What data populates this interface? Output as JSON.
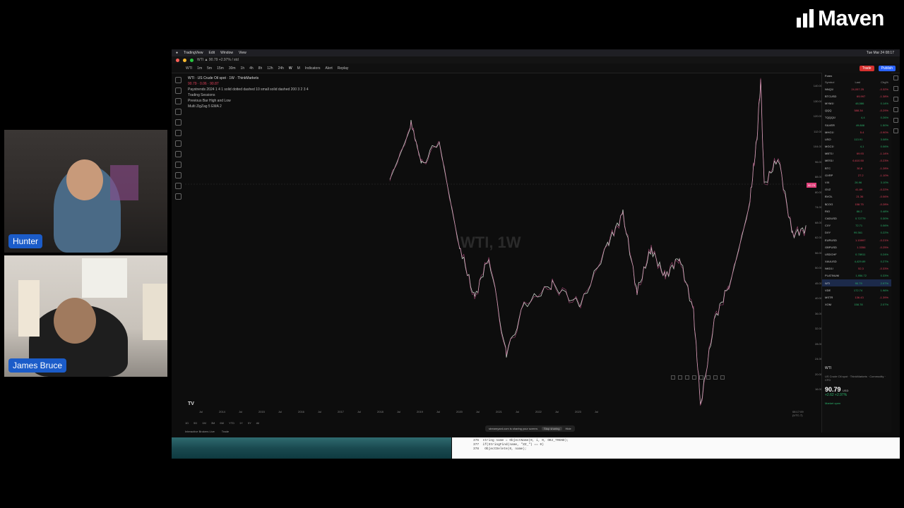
{
  "brand": {
    "name": "Maven"
  },
  "participants": [
    {
      "name": "Hunter"
    },
    {
      "name": "James Bruce"
    }
  ],
  "mac_menu": {
    "app": "TradingView",
    "items": [
      "Edit",
      "Window",
      "View"
    ],
    "datetime": "Tue Mar 24 08:17"
  },
  "browser_tab": {
    "title": "WTI ▲ 90.79 +2.97% / std"
  },
  "toolbar": {
    "symbol": "WTI",
    "intervals": [
      "1m",
      "5m",
      "15m",
      "30m",
      "1h",
      "4h",
      "8h",
      "12h",
      "24h",
      "W",
      "M"
    ],
    "indicators_label": "Indicators",
    "alert_label": "Alert",
    "replay_label": "Replay",
    "trade_label": "Trade",
    "publish_label": "Publish"
  },
  "chart": {
    "title": "WTI · US Crude Oil spot · 1W · ThinkMarkets",
    "ohlc_line": "90.79 · 0.06 · 90.87",
    "indicator_line": "Paystrends 2024 1 4 1 solid dotted dashed 10 small solid dashed 200 3 2 3 4",
    "indicators": [
      "Trading Sessions",
      "Previous Bar High and Low",
      "Multi ZigZag 5 EMA 2"
    ],
    "watermark": "WTI, 1W",
    "price_tag": "90.79",
    "time_labels": [
      "Jul",
      "2014",
      "Jul",
      "2015",
      "Jul",
      "2016",
      "Jul",
      "2017",
      "Jul",
      "2018",
      "Jul",
      "2019",
      "Jul",
      "2020",
      "Jul",
      "2021",
      "Jul",
      "2022",
      "Jul",
      "2023",
      "Jul"
    ],
    "timestamp": "08:17:09 (UTC-7)",
    "price_labels": [
      "140.00",
      "130.00",
      "120.00",
      "112.00",
      "104.00",
      "96.00",
      "88.00",
      "80.00",
      "74.00",
      "68.00",
      "62.00",
      "56.00",
      "50.00",
      "45.00",
      "40.00",
      "36.00",
      "32.00",
      "28.00",
      "24.00",
      "20.00",
      "16.00"
    ],
    "usd_label": "USD"
  },
  "bottom_bar": {
    "ranges": [
      "1D",
      "5D",
      "1M",
      "3M",
      "6M",
      "YTD",
      "1Y",
      "5Y",
      "All"
    ],
    "broker": "Interactive Brokers Live",
    "trade": "Trade"
  },
  "screenshare": {
    "text": "streamyard.com is sharing your screen.",
    "stop": "Stop sharing",
    "hide": "Hide"
  },
  "watchlist": {
    "title": "Forex",
    "headers": {
      "symbol": "Symbol",
      "last": "Last",
      "chg": "Chg%"
    },
    "rows": [
      {
        "symbol": "NNQ1!",
        "last": "24,057.25",
        "chg": "-0.32%",
        "dir": "down"
      },
      {
        "symbol": "BTCUSD",
        "last": "69,997",
        "chg": "-1.38%",
        "dir": "down"
      },
      {
        "symbol": "MYM1!",
        "last": "48,586",
        "chg": "0.14%",
        "dir": "up"
      },
      {
        "symbol": "QQQ",
        "last": "588.34",
        "chg": "-0.29%",
        "dir": "down"
      },
      {
        "symbol": "TQQQ1!",
        "last": "4,4",
        "chg": "0.26%",
        "dir": "up"
      },
      {
        "symbol": "SILVER",
        "last": "49.888",
        "chg": "1.50%",
        "dir": "up"
      },
      {
        "symbol": "MHG1!",
        "last": "5.4",
        "chg": "-0.90%",
        "dir": "down"
      },
      {
        "symbol": "USO",
        "last": "113.91",
        "chg": "3.08%",
        "dir": "up"
      },
      {
        "symbol": "MGC1!",
        "last": "4,1",
        "chg": "0.06%",
        "dir": "up"
      },
      {
        "symbol": "MBT1!",
        "last": "69.93",
        "chg": "-1.14%",
        "dir": "down"
      },
      {
        "symbol": "MES1!",
        "last": "6,610.50",
        "chg": "-0.23%",
        "dir": "down"
      },
      {
        "symbol": "BTC",
        "last": "30.8",
        "chg": "-1.28%",
        "dir": "down"
      },
      {
        "symbol": "GXRP",
        "last": "27.2",
        "chg": "-1.10%",
        "dir": "down"
      },
      {
        "symbol": "VIX",
        "last": "26.96",
        "chg": "3.10%",
        "dir": "up"
      },
      {
        "symbol": "GVZ",
        "last": "41.89",
        "chg": "-0.22%",
        "dir": "down"
      },
      {
        "symbol": "BVOL",
        "last": "21.36",
        "chg": "-0.06%",
        "dir": "down"
      },
      {
        "symbol": "$COG",
        "last": "158.75",
        "chg": "-0.28%",
        "dir": "down"
      },
      {
        "symbol": "RIO",
        "last": "86.2",
        "chg": "0.48%",
        "dir": "up"
      },
      {
        "symbol": "CADUSD",
        "last": "0.72779",
        "chg": "0.30%",
        "dir": "up"
      },
      {
        "symbol": "CXY",
        "last": "72.71",
        "chg": "0.06%",
        "dir": "up"
      },
      {
        "symbol": "DXY",
        "last": "99.361",
        "chg": "0.22%",
        "dir": "up"
      },
      {
        "symbol": "EURUSD",
        "last": "1.15997",
        "chg": "-0.21%",
        "dir": "down"
      },
      {
        "symbol": "GBPUSD",
        "last": "1.3356",
        "chg": "-0.25%",
        "dir": "down"
      },
      {
        "symbol": "USDCHF",
        "last": "0.78911",
        "chg": "0.24%",
        "dir": "up"
      },
      {
        "symbol": "XAUUSD",
        "last": "4,429.89",
        "chg": "0.27%",
        "dir": "up"
      },
      {
        "symbol": "NKD1!",
        "last": "52,3",
        "chg": "-0.33%",
        "dir": "down"
      },
      {
        "symbol": "PLATINUM",
        "last": "1,956.72",
        "chg": "0.33%",
        "dir": "up"
      },
      {
        "symbol": "WTI",
        "last": "90.79",
        "chg": "2.97%",
        "dir": "up",
        "selected": true
      },
      {
        "symbol": "VDE",
        "last": "172.74",
        "chg": "1.96%",
        "dir": "up"
      },
      {
        "symbol": "MSTR",
        "last": "136.43",
        "chg": "-1.39%",
        "dir": "down"
      },
      {
        "symbol": "XOM",
        "last": "158.78",
        "chg": "2.07%",
        "dir": "up"
      }
    ]
  },
  "detail": {
    "symbol": "WTI",
    "description": "US Crude Oil spot · ThinkMarkets · Commodity · CFD",
    "market_status": "Market open",
    "price": "90.79",
    "price_unit": "USD",
    "change": "+2.62 +2.97%"
  },
  "code_snippet": {
    "lines": [
      "string name = ObjectName(0, i, 0, OBJ_TREND);",
      "if(StringFind(name, \"ZZ_\") == 0)",
      "   ObjectDelete(0, name);"
    ],
    "line_numbers": [
      "376",
      "377",
      "378"
    ]
  },
  "colors": {
    "accent": "#2962ff",
    "up": "#2bb36b",
    "down": "#e0405a",
    "name_tag": "#1b5cc9"
  }
}
